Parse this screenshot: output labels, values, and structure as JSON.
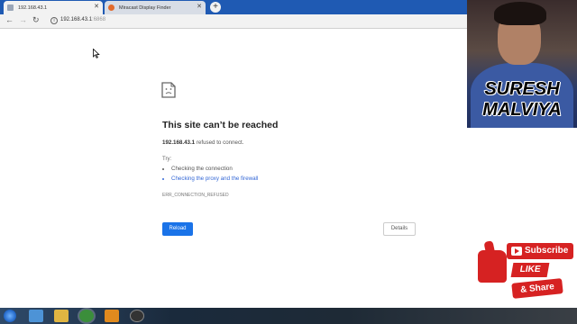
{
  "tabs": [
    {
      "label": "192.168.43.1"
    },
    {
      "label": "Miracast Display Finder"
    }
  ],
  "toolbar": {
    "url_host": "192.168.43.1",
    "url_port": ":6868"
  },
  "error": {
    "title": "This site can’t be reached",
    "host": "192.168.43.1",
    "message": " refused to connect.",
    "try_label": "Try:",
    "suggestions": [
      "Checking the connection",
      "Checking the proxy and the firewall"
    ],
    "code": "ERR_CONNECTION_REFUSED",
    "reload_label": "Reload",
    "details_label": "Details"
  },
  "overlay": {
    "name_line1": "SURESH",
    "name_line2": "MALVIYA"
  },
  "promo": {
    "subscribe": "Subscribe",
    "like": "LIKE",
    "share": "& Share"
  },
  "taskbar": {
    "icons": [
      "start-icon",
      "internet-explorer-icon",
      "file-explorer-icon",
      "chrome-icon",
      "sublime-text-icon",
      "obs-icon"
    ]
  },
  "colors": {
    "tabstrip": "#1f5ab3",
    "link": "#3367d6",
    "reload_button": "#1a73e8",
    "promo_red": "#d62222"
  }
}
